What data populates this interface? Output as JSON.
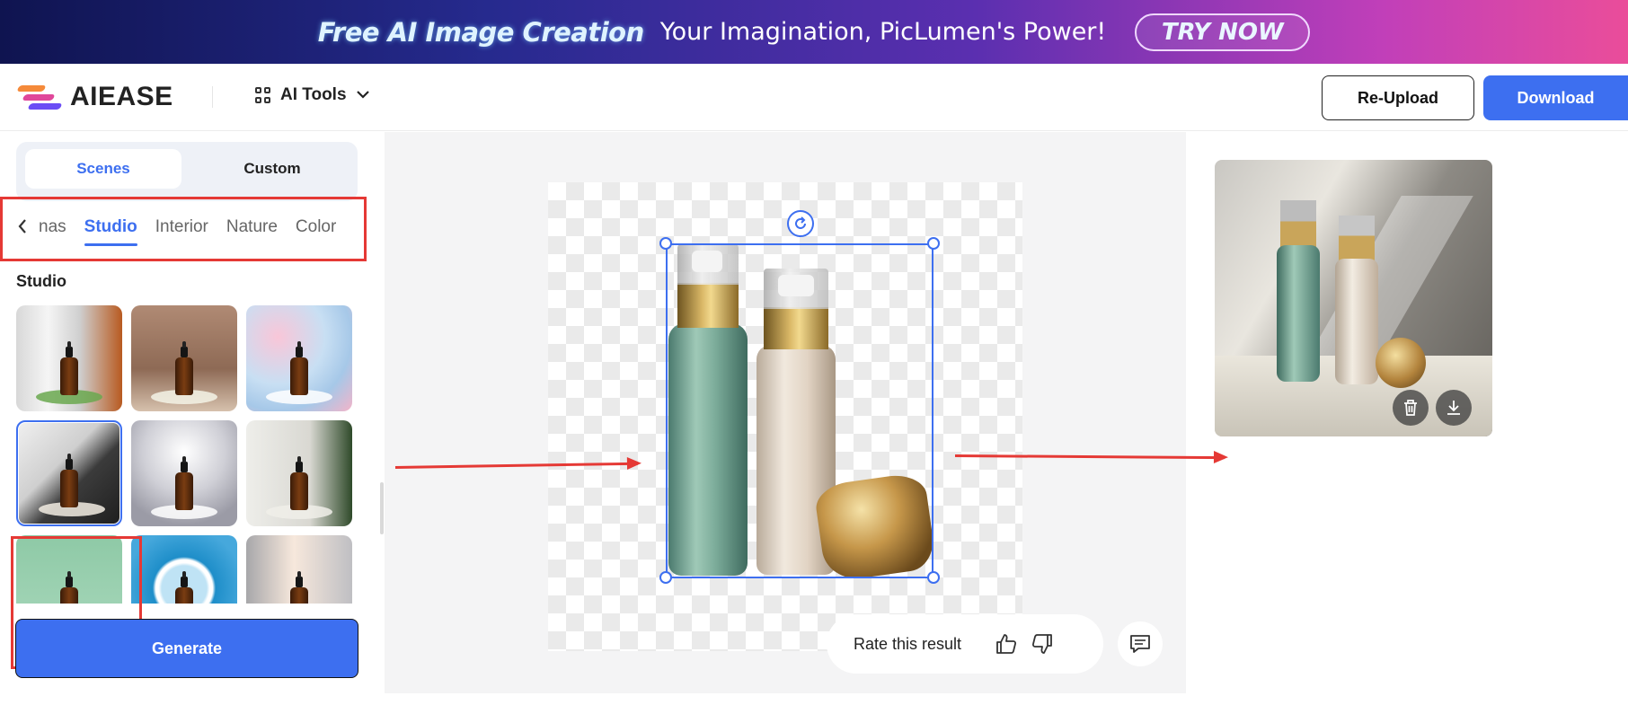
{
  "banner": {
    "title": "Free AI Image Creation",
    "subtitle": "Your Imagination, PicLumen's Power!",
    "cta": "TRY NOW"
  },
  "header": {
    "logo_text": "AIEASE",
    "ai_tools_label": "AI Tools",
    "reupload_label": "Re-Upload",
    "download_label": "Download"
  },
  "sidebar": {
    "mode_tabs": [
      "Scenes",
      "Custom"
    ],
    "active_mode": "Scenes",
    "categories": [
      "nas",
      "Studio",
      "Interior",
      "Nature",
      "Color"
    ],
    "active_category": "Studio",
    "section_title": "Studio",
    "thumbnails": [
      {
        "name": "thumb-window-leaves",
        "bg": "linear-gradient(90deg,#d8d8d8,#f5f5f5 30%,#cfcfcf 60%,#b85a20)",
        "accent": "#6aa84f"
      },
      {
        "name": "thumb-white-flowers",
        "bg": "linear-gradient(180deg,#b08a74,#8e6a55 60%,#d6c1ad)",
        "accent": "#f3f3e6"
      },
      {
        "name": "thumb-pastel-bokeh",
        "bg": "radial-gradient(circle at 30% 30%,#f9c6d8,#c8dff3 45%,#a6c8e8 70%,#f3b4c9)",
        "accent": "#ffffff"
      },
      {
        "name": "thumb-dark-pedestal",
        "bg": "linear-gradient(135deg,#efefef 0%,#cfcfcf 40%,#3b3b3b 60%,#1f1f1f 100%)",
        "accent": "#f3ede3"
      },
      {
        "name": "thumb-silver-bokeh",
        "bg": "radial-gradient(circle at 50% 30%,#ffffff,#cfcfd6 45%,#9b9ba6 80%)",
        "accent": "#ffffff"
      },
      {
        "name": "thumb-palm-leaf",
        "bg": "linear-gradient(90deg,#eeeeea,#d9d8d2 60%,#2f4a2a)",
        "accent": "#f0efe9"
      },
      {
        "name": "thumb-mint-wall",
        "bg": "linear-gradient(180deg,#8ec9a6,#a8d8bb)",
        "accent": "#ffffff"
      },
      {
        "name": "thumb-blue-ring",
        "bg": "radial-gradient(circle at 50% 50%,#bfe3f5 30%,#ffffff 34%,#ffffff 38%,#1e8ec9 42%,#46a8dc 80%)",
        "accent": "#ffffff"
      },
      {
        "name": "thumb-soft-light",
        "bg": "linear-gradient(90deg,#a7a7aa,#f7e8dc 45%,#bfbfc3)",
        "accent": "#ffffff"
      }
    ],
    "selected_thumbnail": 3,
    "generate_label": "Generate"
  },
  "canvas": {
    "rotate_icon": "rotate-icon",
    "rate_label": "Rate this result",
    "thumbs_up_icon": "thumbs-up-icon",
    "thumbs_down_icon": "thumbs-down-icon",
    "feedback_icon": "message-icon"
  },
  "result": {
    "delete_icon": "trash-icon",
    "download_icon": "download-icon"
  },
  "colors": {
    "accent": "#3d6ff0",
    "annotation_red": "#e53935"
  }
}
